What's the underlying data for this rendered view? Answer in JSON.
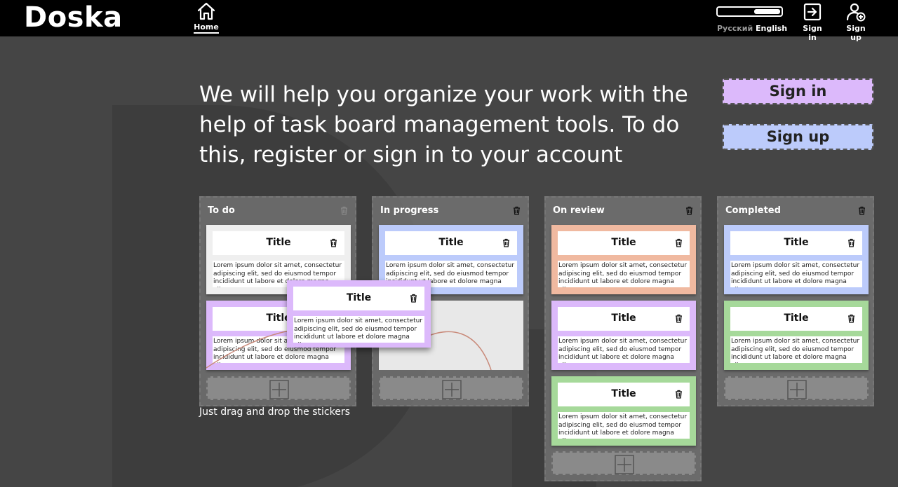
{
  "header": {
    "logo": "Doska",
    "nav_home_label": "Home",
    "lang_ru": "Русский",
    "lang_en": "English",
    "signin_label": "Sign in",
    "signup_label": "Sign up"
  },
  "hero": {
    "text": "We will help you organize your work with the help of task board management tools. To do this, register or sign in to your account"
  },
  "cta": {
    "signin": "Sign in",
    "signup": "Sign up"
  },
  "colors": {
    "purple": "#dcb9fb",
    "blue": "#bccbfb",
    "orange": "#f0b9a0",
    "green": "#a6d99a",
    "grey": "#efefef"
  },
  "columns": [
    {
      "title": "To do",
      "cards": [
        {
          "title": "Title",
          "body": "Lorem ipsum dolor sit amet, consectetur adipiscing elit, sed do eiusmod tempor incididunt ut labore et dolore magna aliqua.",
          "color": "#efefef"
        },
        {
          "title": "Title",
          "body": "Lorem ipsum dolor sit amet, consectetur adipiscing elit, sed do eiusmod tempor incididunt ut labore et dolore magna aliqua.",
          "color": "#dcb9fb"
        }
      ]
    },
    {
      "title": "In progress",
      "cards": [
        {
          "title": "Title",
          "body": "Lorem ipsum dolor sit amet, consectetur adipiscing elit, sed do eiusmod tempor incididunt ut labore et dolore magna aliqua.",
          "color": "#bccbfb"
        }
      ]
    },
    {
      "title": "On review",
      "cards": [
        {
          "title": "Title",
          "body": "Lorem ipsum dolor sit amet, consectetur adipiscing elit, sed do eiusmod tempor incididunt ut labore et dolore magna aliqua.",
          "color": "#f0b9a0"
        },
        {
          "title": "Title",
          "body": "Lorem ipsum dolor sit amet, consectetur adipiscing elit, sed do eiusmod tempor incididunt ut labore et dolore magna aliqua.",
          "color": "#dcb9fb"
        },
        {
          "title": "Title",
          "body": "Lorem ipsum dolor sit amet, consectetur adipiscing elit, sed do eiusmod tempor incididunt ut labore et dolore magna aliqua.",
          "color": "#a6d99a"
        }
      ]
    },
    {
      "title": "Completed",
      "cards": [
        {
          "title": "Title",
          "body": "Lorem ipsum dolor sit amet, consectetur adipiscing elit, sed do eiusmod tempor incididunt ut labore et dolore magna aliqua.",
          "color": "#bccbfb"
        },
        {
          "title": "Title",
          "body": "Lorem ipsum dolor sit amet, consectetur adipiscing elit, sed do eiusmod tempor incididunt ut labore et dolore magna aliqua.",
          "color": "#a6d99a"
        }
      ]
    }
  ],
  "dragging_card": {
    "title": "Title",
    "body": "Lorem ipsum dolor sit amet, consectetur adipiscing elit, sed do eiusmod tempor incididunt ut labore et dolore magna aliqua.",
    "color": "#dcb9fb"
  },
  "caption": "Just drag and drop the stickers"
}
